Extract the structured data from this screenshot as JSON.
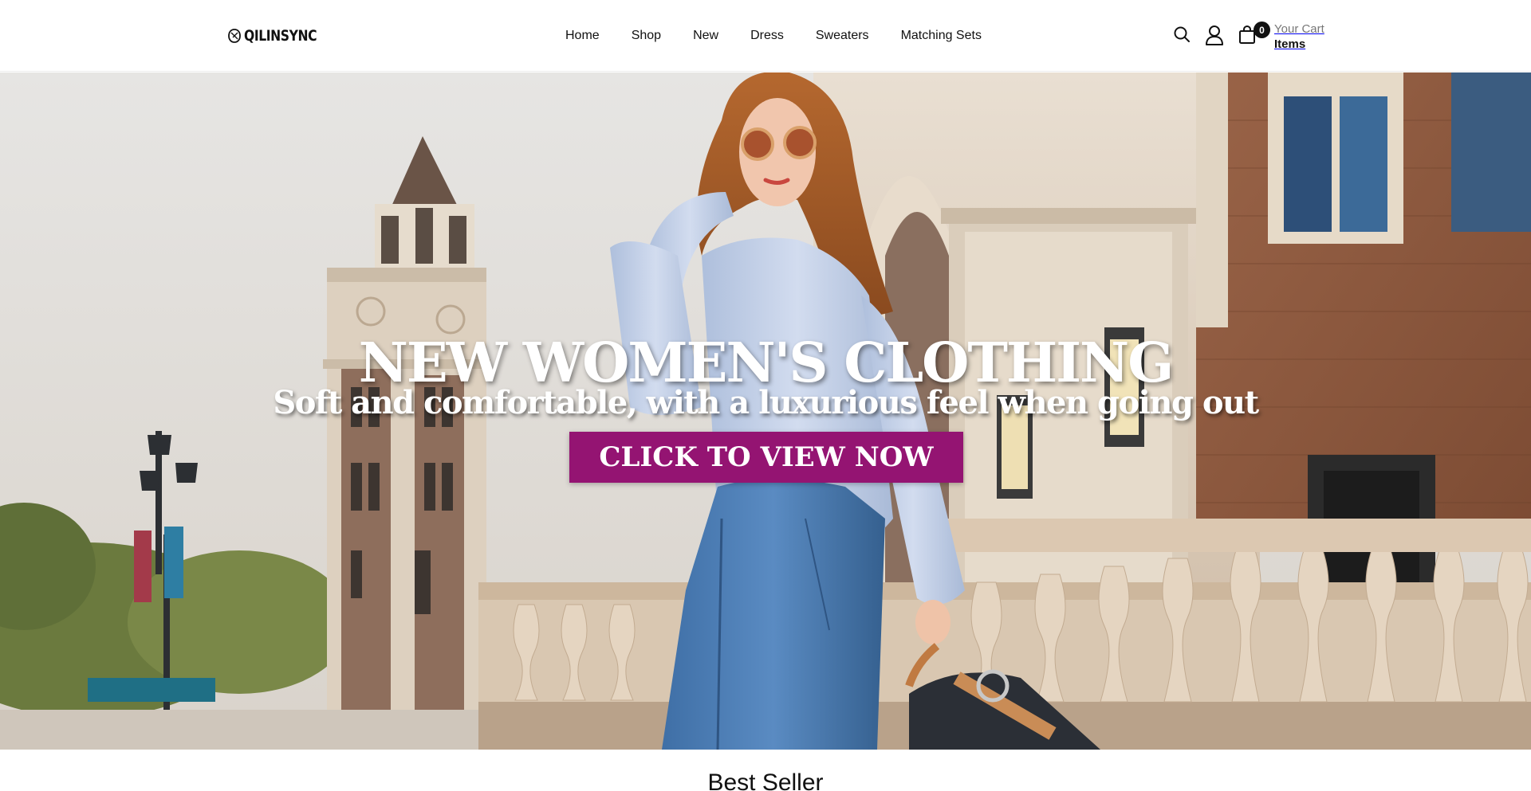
{
  "brand": {
    "name": "QILINSYNC"
  },
  "nav": {
    "items": [
      {
        "label": "Home"
      },
      {
        "label": "Shop"
      },
      {
        "label": "New"
      },
      {
        "label": "Dress"
      },
      {
        "label": "Sweaters"
      },
      {
        "label": "Matching Sets"
      }
    ]
  },
  "header_icons": {
    "search": "search-icon",
    "account": "user-icon",
    "cart": "shopping-bag-icon"
  },
  "cart": {
    "count": "0",
    "label": "Your Cart",
    "items_label": "Items"
  },
  "hero": {
    "title": "NEW WOMEN'S CLOTHING",
    "subtitle": "Soft and comfortable, with a luxurious feel when going out",
    "cta_label": "CLICK TO VIEW NOW",
    "cta_color": "#941472"
  },
  "sections": {
    "best_seller_title": "Best Seller"
  }
}
